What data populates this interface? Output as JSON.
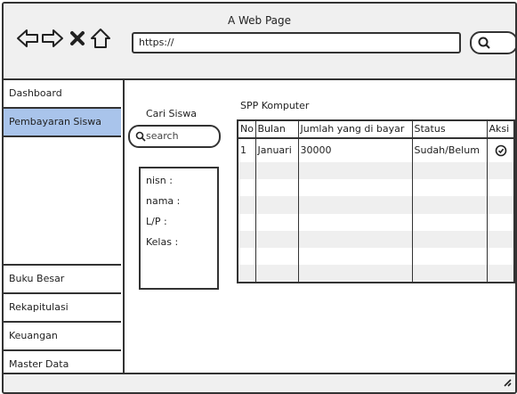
{
  "browser": {
    "page_title": "A Web Page",
    "url": "https://"
  },
  "sidebar": {
    "items": [
      {
        "label": "Dashboard",
        "active": false
      },
      {
        "label": "Pembayaran Siswa",
        "active": true
      },
      {
        "label": "Buku Besar",
        "active": false
      },
      {
        "label": "Rekapitulasi",
        "active": false
      },
      {
        "label": "Keuangan",
        "active": false
      },
      {
        "label": "Master Data",
        "active": false
      }
    ]
  },
  "search": {
    "label": "Cari Siswa",
    "placeholder": "search"
  },
  "student_info": {
    "nisn": "nisn :",
    "nama": "nama :",
    "gender": "L/P :",
    "kelas": "Kelas :"
  },
  "table": {
    "title": "SPP Komputer",
    "headers": [
      "No",
      "Bulan",
      "Jumlah yang di bayar",
      "Status",
      "Aksi"
    ],
    "rows": [
      {
        "no": "1",
        "bulan": "Januari",
        "jumlah": "30000",
        "status": "Sudah/Belum",
        "aksi_icon": "check-circle-icon"
      }
    ]
  },
  "colors": {
    "active_item": "#a9c4eb",
    "chrome": "#f0f0f0",
    "stripe": "#efefef"
  }
}
